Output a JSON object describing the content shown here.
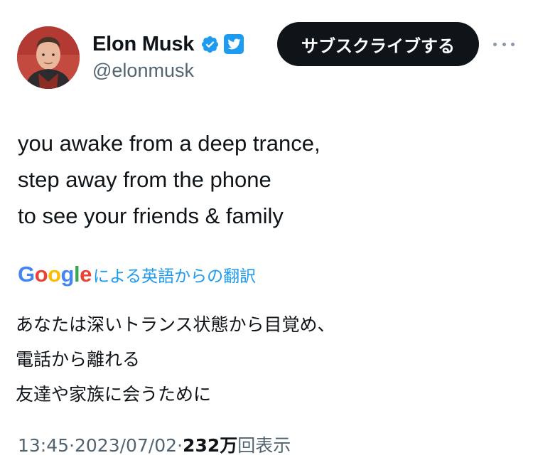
{
  "user": {
    "display_name": "Elon Musk",
    "handle": "@elonmusk",
    "avatar_icon": "profile-photo",
    "verified_icon": "verified-badge-icon",
    "affiliate_icon": "twitter-bird-icon"
  },
  "actions": {
    "subscribe_label": "サブスクライブする",
    "more_icon": "more-options-icon"
  },
  "tweet": {
    "lines": [
      "you awake from a deep trance,",
      "step away from the phone",
      "to see your friends & family"
    ]
  },
  "translation": {
    "provider_logo": "Google",
    "label": "による英語からの翻訳",
    "lines": [
      "あなたは深いトランス状態から目覚め、",
      "電話から離れる",
      "友達や家族に会うために"
    ]
  },
  "meta": {
    "time": "13:45",
    "separator": " · ",
    "date": "2023/07/02",
    "views_count": "232万",
    "views_label": "回表示"
  },
  "colors": {
    "text_primary": "#0f1419",
    "text_secondary": "#536471",
    "accent_blue": "#1d9bf0",
    "button_dark": "#0f1419"
  }
}
